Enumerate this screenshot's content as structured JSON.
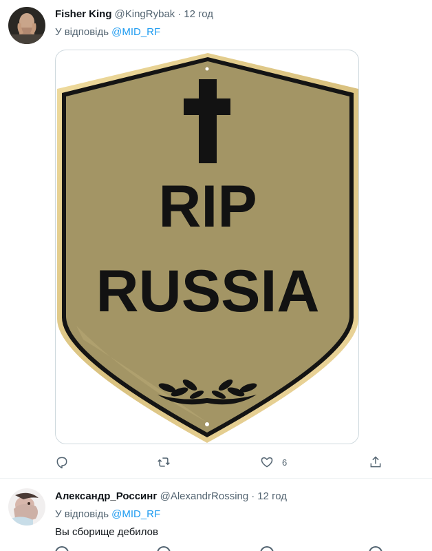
{
  "tweets": [
    {
      "author": {
        "name": "Fisher King",
        "handle": "@KingRybak",
        "time": "12 год"
      },
      "replying_prefix": "У відповідь",
      "replying_to": "@MID_RF",
      "image": {
        "alt_text": [
          "RIP",
          "RUSSIA"
        ],
        "shield_color": "#a39565",
        "border_color": "#e5cf91"
      },
      "actions": {
        "replies": "",
        "retweets": "",
        "likes": "6"
      }
    },
    {
      "author": {
        "name": "Александр_Россинг",
        "handle": "@AlexandrRossing",
        "time": "12 год"
      },
      "replying_prefix": "У відповідь",
      "replying_to": "@MID_RF",
      "text": "Вы сборище дебилов"
    }
  ],
  "colors": {
    "accent": "#1d9bf0",
    "secondary_text": "#536471",
    "divider": "#eff3f4"
  },
  "icons": [
    "reply-icon",
    "retweet-icon",
    "like-icon",
    "share-icon"
  ]
}
